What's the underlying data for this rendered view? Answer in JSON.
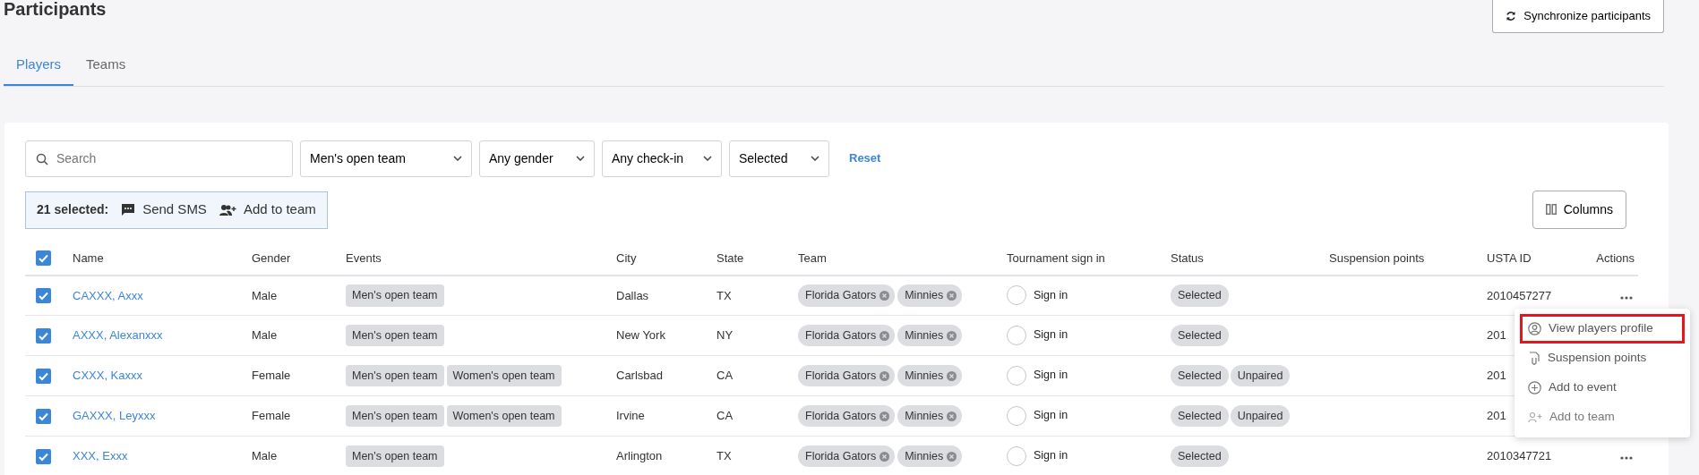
{
  "page": {
    "title": "Participants",
    "sync_button": "Synchronize participants"
  },
  "tabs": [
    {
      "label": "Players",
      "selected": true
    },
    {
      "label": "Teams",
      "selected": false
    }
  ],
  "filters": {
    "search": {
      "placeholder": "Search"
    },
    "dropdowns": [
      "Men's open team",
      "Any gender",
      "Any check-in",
      "Selected"
    ],
    "reset": "Reset"
  },
  "selection_bar": {
    "count": "21 selected:",
    "actions": [
      {
        "kind": "sms",
        "label": "Send SMS"
      },
      {
        "kind": "team",
        "label": "Add to team"
      }
    ]
  },
  "columns_button": "Columns",
  "table": {
    "all_checked": true,
    "columns": [
      "Name",
      "Gender",
      "Events",
      "City",
      "State",
      "Team",
      "Tournament sign in",
      "Status",
      "Suspension points",
      "USTA ID",
      "Actions"
    ],
    "rows": [
      {
        "checked": true,
        "name": "CAXXX, Axxx",
        "gender": "Male",
        "events": [
          "Men's open team"
        ],
        "city": "Dallas",
        "state": "TX",
        "teams": [
          "Florida Gators",
          "Minnies"
        ],
        "sign_in": "Sign in",
        "signed_in": false,
        "status": [
          "Selected"
        ],
        "usta_id": "2010457277",
        "more_button": true
      },
      {
        "checked": true,
        "name": "AXXX, Alexanxxx",
        "gender": "Male",
        "events": [
          "Men's open team"
        ],
        "city": "New York",
        "state": "NY",
        "teams": [
          "Florida Gators",
          "Minnies"
        ],
        "sign_in": "Sign in",
        "signed_in": false,
        "status": [
          "Selected"
        ],
        "usta_id": "201",
        "more_button": false
      },
      {
        "checked": true,
        "name": "CXXX, Kaxxx",
        "gender": "Female",
        "events": [
          "Men's open team",
          "Women's open team"
        ],
        "city": "Carlsbad",
        "state": "CA",
        "teams": [
          "Florida Gators",
          "Minnies"
        ],
        "sign_in": "Sign in",
        "signed_in": false,
        "status": [
          "Selected",
          "Unpaired"
        ],
        "usta_id": "201",
        "more_button": false
      },
      {
        "checked": true,
        "name": "GAXXX, Leyxxx",
        "gender": "Female",
        "events": [
          "Men's open team",
          "Women's open team"
        ],
        "city": "Irvine",
        "state": "CA",
        "teams": [
          "Florida Gators",
          "Minnies"
        ],
        "sign_in": "Sign in",
        "signed_in": false,
        "status": [
          "Selected",
          "Unpaired"
        ],
        "usta_id": "201",
        "more_button": false
      },
      {
        "checked": true,
        "name": "XXX, Exxx",
        "gender": "Male",
        "events": [
          "Men's open team"
        ],
        "city": "Arlington",
        "state": "TX",
        "teams": [
          "Florida Gators",
          "Minnies"
        ],
        "sign_in": "Sign in",
        "signed_in": false,
        "status": [
          "Selected"
        ],
        "usta_id": "2010347721",
        "more_button": true
      }
    ]
  },
  "action_menu": {
    "items": [
      {
        "kind": "profile",
        "label": "View players profile",
        "highlighted": true,
        "disabled": false
      },
      {
        "kind": "points",
        "label": "Suspension points",
        "highlighted": false,
        "disabled": false
      },
      {
        "kind": "event",
        "label": "Add to event",
        "highlighted": false,
        "disabled": false
      },
      {
        "kind": "team",
        "label": "Add to team",
        "highlighted": false,
        "disabled": true
      }
    ]
  }
}
